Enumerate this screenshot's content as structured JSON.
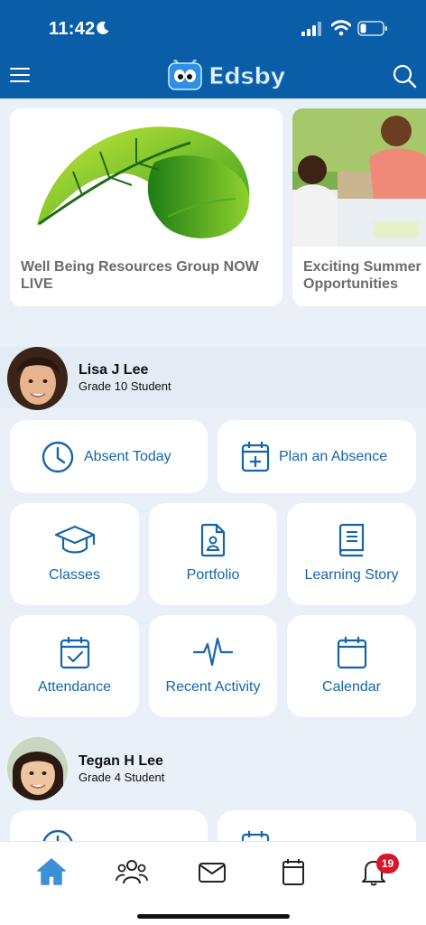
{
  "status_bar": {
    "time": "11:42"
  },
  "app": {
    "name": "Edsby"
  },
  "news": [
    {
      "title": "Well Being Resources Group NOW LIVE"
    },
    {
      "title": "Exciting Summer Opportunities"
    }
  ],
  "students": [
    {
      "name": "Lisa J Lee",
      "grade": "Grade 10 Student",
      "actions": {
        "absent_today": "Absent Today",
        "plan_absence": "Plan an Absence",
        "classes": "Classes",
        "portfolio": "Portfolio",
        "learning_story": "Learning Story",
        "attendance": "Attendance",
        "recent_activity": "Recent Activity",
        "calendar": "Calendar"
      }
    },
    {
      "name": "Tegan H Lee",
      "grade": "Grade 4 Student"
    }
  ],
  "bottom_nav": {
    "items": [
      "home-icon",
      "people-icon",
      "mail-icon",
      "calendar-icon",
      "bell-icon"
    ],
    "notification_count": "19"
  },
  "colors": {
    "brand": "#0a5ea8",
    "accent": "#1565a8",
    "badge": "#d8152a"
  }
}
